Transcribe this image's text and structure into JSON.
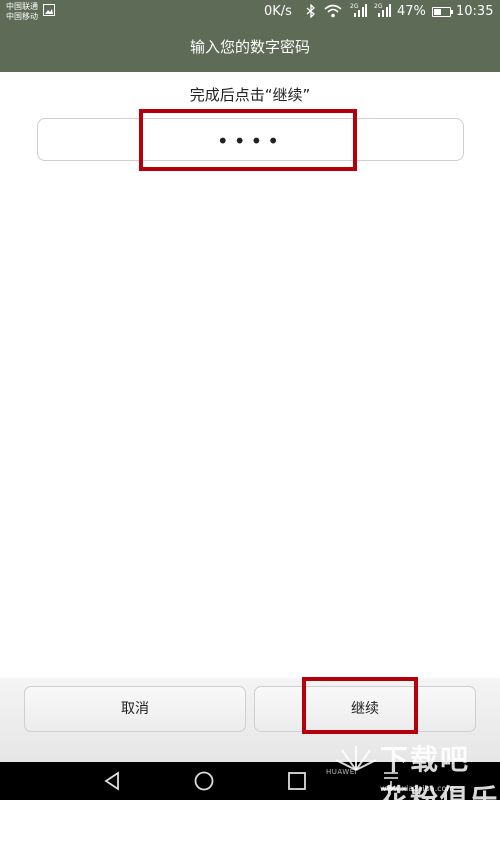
{
  "status_bar": {
    "carrier_1": "中国联通",
    "carrier_2": "中国移动",
    "net_speed": "0K/s",
    "network_badge": "2G",
    "battery_percent": "47%",
    "battery_level": 0.47,
    "time": "10:35"
  },
  "header": {
    "title": "输入您的数字密码"
  },
  "main": {
    "instruction": "完成后点击“继续”",
    "pin_display": "••••"
  },
  "buttons": {
    "cancel": "取消",
    "continue": "继续"
  },
  "nav_bar": {
    "brand": "HUAWEI",
    "icons": [
      "back-icon",
      "home-icon",
      "recents-icon",
      "notification-menu-icon"
    ]
  },
  "watermark": {
    "main": "下载吧 花粉俱乐部",
    "sub": "www.xiazaiba.com"
  },
  "colors": {
    "header_bg": "#5d6b57",
    "annotation": "#b5000b",
    "nav_bg": "#000000"
  }
}
